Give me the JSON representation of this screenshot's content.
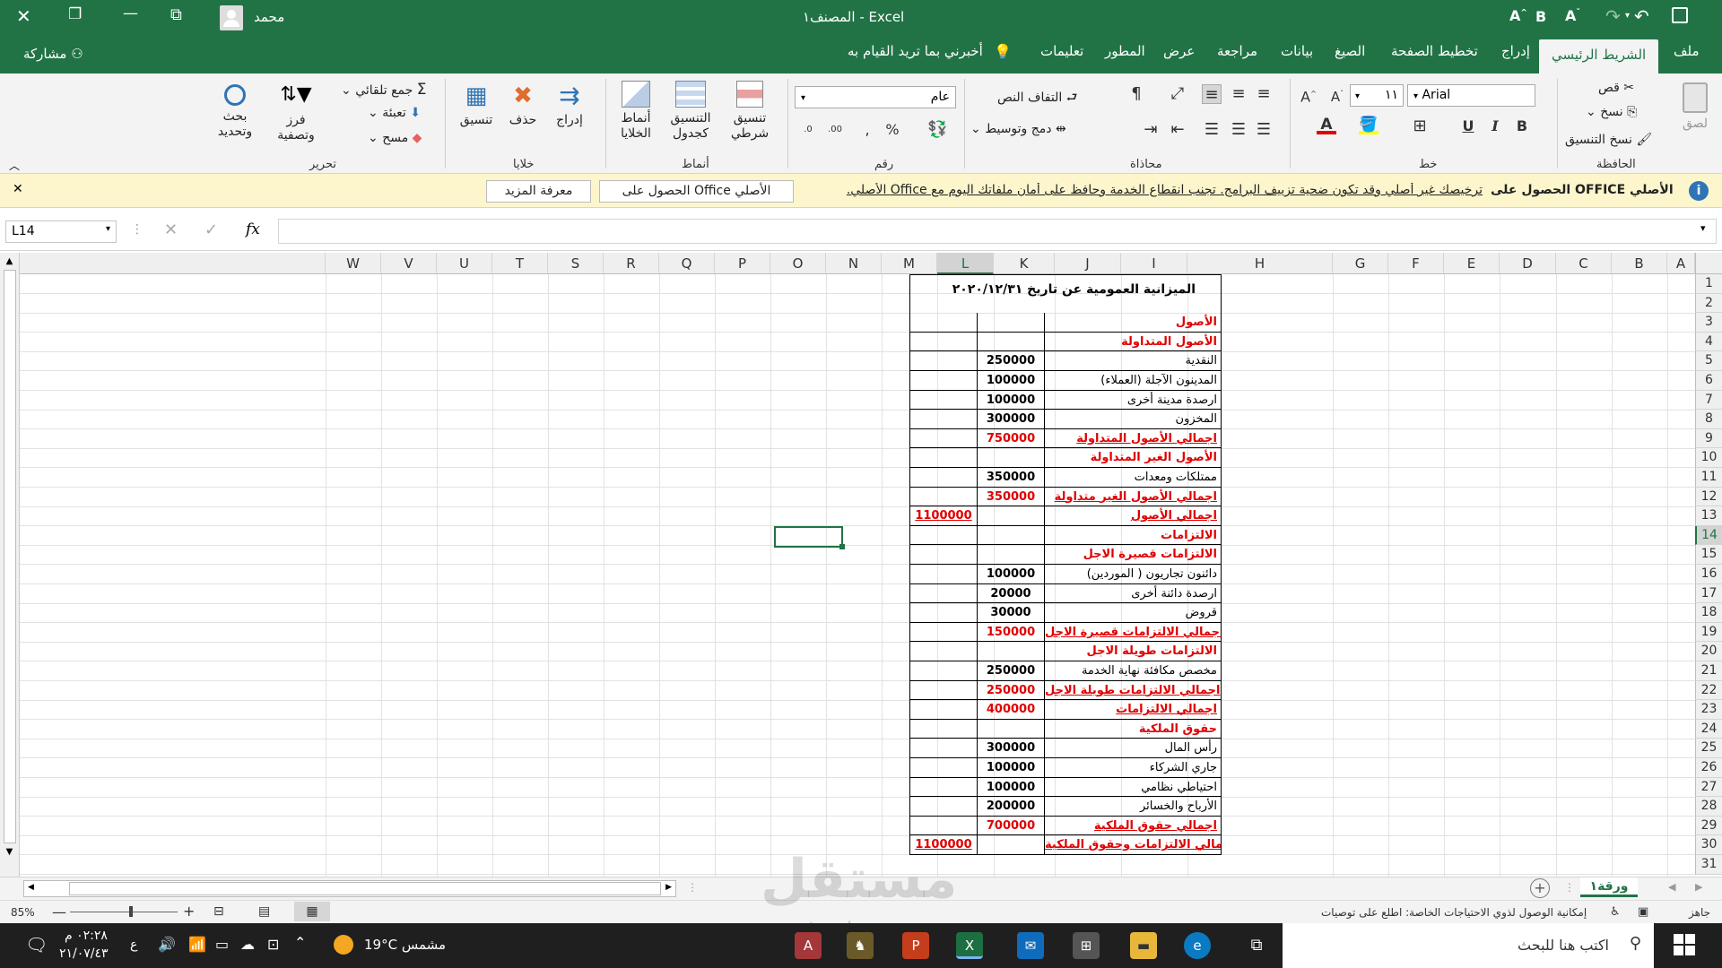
{
  "titlebar": {
    "title": "المصنف١  -  Excel",
    "user": "محمد",
    "close": "✕",
    "restore": "❐",
    "minimize": "—",
    "ribbon_display": "⧉"
  },
  "tabs": [
    "ملف",
    "الشريط الرئيسي",
    "إدراج",
    "تخطيط الصفحة",
    "الصيغ",
    "بيانات",
    "مراجعة",
    "عرض",
    "المطور",
    "تعليمات",
    "أخبرني بما تريد القيام به"
  ],
  "share": "مشاركة",
  "ribbon": {
    "clipboard": {
      "group": "الحافظة",
      "paste": "لصق",
      "cut": "قص",
      "copy": "نسخ",
      "format_painter": "نسخ التنسيق"
    },
    "font": {
      "group": "خط",
      "name": "Arial",
      "size": "١١",
      "bold": "B",
      "italic": "I",
      "underline": "U"
    },
    "alignment": {
      "group": "محاذاة",
      "wrap": "التفاف النص",
      "merge": "دمج وتوسيط"
    },
    "number": {
      "group": "رقم",
      "format": "عام"
    },
    "styles": {
      "group": "أنماط",
      "conditional": "تنسيق شرطي",
      "table": "التنسيق كجدول",
      "cell_styles": "أنماط الخلايا"
    },
    "cells": {
      "group": "خلايا",
      "insert": "إدراج",
      "delete": "حذف",
      "format": "تنسيق"
    },
    "editing": {
      "group": "تحرير",
      "autosum": "جمع تلقائي",
      "fill": "تعبئة",
      "clear": "مسح",
      "sort": "فرز وتصفية",
      "find": "بحث وتحديد"
    }
  },
  "notice": {
    "title": "الحصول على OFFICE الأصلي",
    "message": "ترخيصك غير أصلي وقد تكون ضحية تزييف البرامج. تجنب انقطاع الخدمة وحافظ على أمان ملفاتك اليوم مع Office الأصلي.",
    "btn_get": "الحصول على Office الأصلي",
    "btn_more": "معرفة المزيد"
  },
  "formula_bar": {
    "name_box": "L14",
    "fx": "fx",
    "value": ""
  },
  "columns": [
    "A",
    "B",
    "C",
    "D",
    "E",
    "F",
    "G",
    "H",
    "I",
    "J",
    "K",
    "L",
    "M",
    "N",
    "O",
    "P",
    "Q",
    "R",
    "S",
    "T",
    "U",
    "V",
    "W"
  ],
  "rows": [
    "1",
    "2",
    "3",
    "4",
    "5",
    "6",
    "7",
    "8",
    "9",
    "10",
    "11",
    "12",
    "13",
    "14",
    "15",
    "16",
    "17",
    "18",
    "19",
    "20",
    "21",
    "22",
    "23",
    "24",
    "25",
    "26",
    "27",
    "28",
    "29",
    "30",
    "31"
  ],
  "sheet": {
    "title": "الميزانية العمومية عن تاريخ ٢٠٢٠/١٢/٣١",
    "lines": [
      {
        "label": "الأصول",
        "i": "",
        "j": "",
        "style": "head"
      },
      {
        "label": "الأصول المتداولة",
        "i": "",
        "j": "",
        "style": "head"
      },
      {
        "label": "النقدية",
        "i": "250000",
        "j": "",
        "style": ""
      },
      {
        "label": "المدينون الآجلة (العملاء)",
        "i": "100000",
        "j": "",
        "style": ""
      },
      {
        "label": "ارصدة مدينة أخرى",
        "i": "100000",
        "j": "",
        "style": ""
      },
      {
        "label": "المخزون",
        "i": "300000",
        "j": "",
        "style": ""
      },
      {
        "label": "اجمالي الأصول المتداولة",
        "i": "750000",
        "j": "",
        "style": "total"
      },
      {
        "label": "الأصول الغير المتداولة",
        "i": "",
        "j": "",
        "style": "head"
      },
      {
        "label": "ممتلكات ومعدات",
        "i": "350000",
        "j": "",
        "style": ""
      },
      {
        "label": "اجمالي الأصول الغير متداولة",
        "i": "350000",
        "j": "",
        "style": "total"
      },
      {
        "label": "اجمالي الأصول",
        "i": "",
        "j": "1100000",
        "style": "total"
      },
      {
        "label": "الالتزامات",
        "i": "",
        "j": "",
        "style": "head"
      },
      {
        "label": "الالتزامات قصيرة الاجل",
        "i": "",
        "j": "",
        "style": "head"
      },
      {
        "label": "دائنون تجاريون ( الموردين)",
        "i": "100000",
        "j": "",
        "style": ""
      },
      {
        "label": "ارصدة دائنة أخرى",
        "i": "20000",
        "j": "",
        "style": ""
      },
      {
        "label": "قروض",
        "i": "30000",
        "j": "",
        "style": ""
      },
      {
        "label": "اجمالي الالتزامات قصيرة الاجل",
        "i": "150000",
        "j": "",
        "style": "total"
      },
      {
        "label": "الالتزامات طويلة الاجل",
        "i": "",
        "j": "",
        "style": "head"
      },
      {
        "label": "مخصص مكافئة نهاية الخدمة",
        "i": "250000",
        "j": "",
        "style": ""
      },
      {
        "label": "اجمالي الالتزامات طويلة الاجل",
        "i": "250000",
        "j": "",
        "style": "total"
      },
      {
        "label": "اجمالي الالتزامات",
        "i": "400000",
        "j": "",
        "style": "total"
      },
      {
        "label": "حقوق الملكية",
        "i": "",
        "j": "",
        "style": "head"
      },
      {
        "label": "رأس المال",
        "i": "300000",
        "j": "",
        "style": ""
      },
      {
        "label": "جاري الشركاء",
        "i": "100000",
        "j": "",
        "style": ""
      },
      {
        "label": "احتياطي نظامي",
        "i": "100000",
        "j": "",
        "style": ""
      },
      {
        "label": "الأرباح والخسائر",
        "i": "200000",
        "j": "",
        "style": ""
      },
      {
        "label": "اجمالي حقوق الملكية",
        "i": "700000",
        "j": "",
        "style": "total"
      },
      {
        "label": "اجمالي الالتزامات وحقوق الملكية",
        "i": "",
        "j": "1100000",
        "style": "total"
      }
    ]
  },
  "sheet_tab": "ورقة١",
  "status": {
    "ready": "جاهز",
    "accessibility": "إمكانية الوصول لذوي الاحتياجات الخاصة: اطلع على توصيات",
    "zoom": "85%"
  },
  "taskbar": {
    "search": "اكتب هنا للبحث",
    "weather": "19°C  مشمس",
    "time": "٠٢:٢٨ م",
    "date": "٢١/٠٧/٤٣",
    "lang": "ع"
  },
  "watermark": {
    "brand": "مستقل",
    "url": "mostaql.com"
  },
  "colors": {
    "accent": "#217346",
    "red": "#e00000",
    "notice": "#fdf6cc"
  }
}
